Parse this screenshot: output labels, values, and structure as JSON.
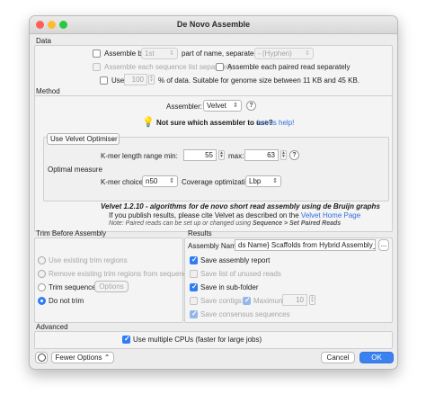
{
  "window": {
    "title": "De Novo Assemble"
  },
  "data_section": {
    "label": "Data",
    "assemble_by_label": "Assemble by:",
    "assemble_by_value": "1st",
    "part_of_name_label": "part of name, separated by",
    "separator_value": "- (Hyphen)",
    "each_list_label": "Assemble each sequence list separately",
    "each_paired_label": "Assemble each paired read separately",
    "use_label": "Use",
    "use_percent_value": "100",
    "use_suffix": "% of data. Suitable for genome size between 11 KB and 45 KB."
  },
  "method_section": {
    "label": "Method",
    "assembler_label": "Assembler:",
    "assembler_value": "Velvet",
    "help_symbol": "?",
    "not_sure_text": "Not sure which assembler to use?",
    "help_link": "Let us help!",
    "optimiser_value": "Use Velvet Optimiser",
    "kmer_range_label": "K-mer length range min:",
    "kmer_min": "55",
    "max_label": "max:",
    "kmer_max": "63",
    "optimal_measure_label": "Optimal measure",
    "kmer_choice_label": "K-mer choice:",
    "kmer_choice_value": "n50",
    "coverage_label": "Coverage optimization:",
    "coverage_value": "Lbp",
    "citation_line1": "Velvet 1.2.10 - algorithms for de novo short read assembly using de Bruijn graphs",
    "citation_line2_prefix": "If you publish results, please cite Velvet as described on the",
    "citation_link": "Velvet Home Page",
    "note_prefix": "Note: Paired reads can be set up or changed using",
    "note_bold": "Sequence > Set Paired Reads"
  },
  "trim_section": {
    "label": "Trim Before Assembly",
    "options": [
      {
        "label": "Use existing trim regions",
        "selected": false,
        "enabled": false
      },
      {
        "label": "Remove existing trim regions from sequences",
        "selected": false,
        "enabled": false
      },
      {
        "label": "Trim sequences",
        "selected": false,
        "enabled": true
      },
      {
        "label": "Do not trim",
        "selected": true,
        "enabled": true
      }
    ],
    "options_button": "Options"
  },
  "results_section": {
    "label": "Results",
    "assembly_name_label": "Assembly Name",
    "assembly_name_value": "ds Name} Scaffolds from Hybrid Assembly_denovo",
    "ellipsis_button": "...",
    "save_report": {
      "label": "Save assembly report",
      "checked": true,
      "enabled": true
    },
    "save_unused": {
      "label": "Save list of unused reads",
      "checked": false,
      "enabled": false
    },
    "save_subfolder": {
      "label": "Save in sub-folder",
      "checked": true,
      "enabled": true
    },
    "save_contigs": {
      "label": "Save contigs",
      "checked": false,
      "enabled": false
    },
    "maximum": {
      "label": "Maximum",
      "checked": true,
      "enabled": false
    },
    "maximum_value": "10",
    "save_consensus": {
      "label": "Save consensus sequences",
      "checked": true,
      "enabled": false
    }
  },
  "advanced_section": {
    "label": "Advanced",
    "multiple_cpus_label": "Use multiple CPUs (faster for large jobs)",
    "multiple_cpus_checked": true
  },
  "footer": {
    "fewer_options": "Fewer Options",
    "cancel": "Cancel",
    "ok": "OK"
  },
  "colors": {
    "accent": "#2f7cf6",
    "ok_button": "#3b82f0",
    "close_light": "#fe5f57",
    "minimize_light": "#febc2e",
    "zoom_light": "#28c840"
  }
}
